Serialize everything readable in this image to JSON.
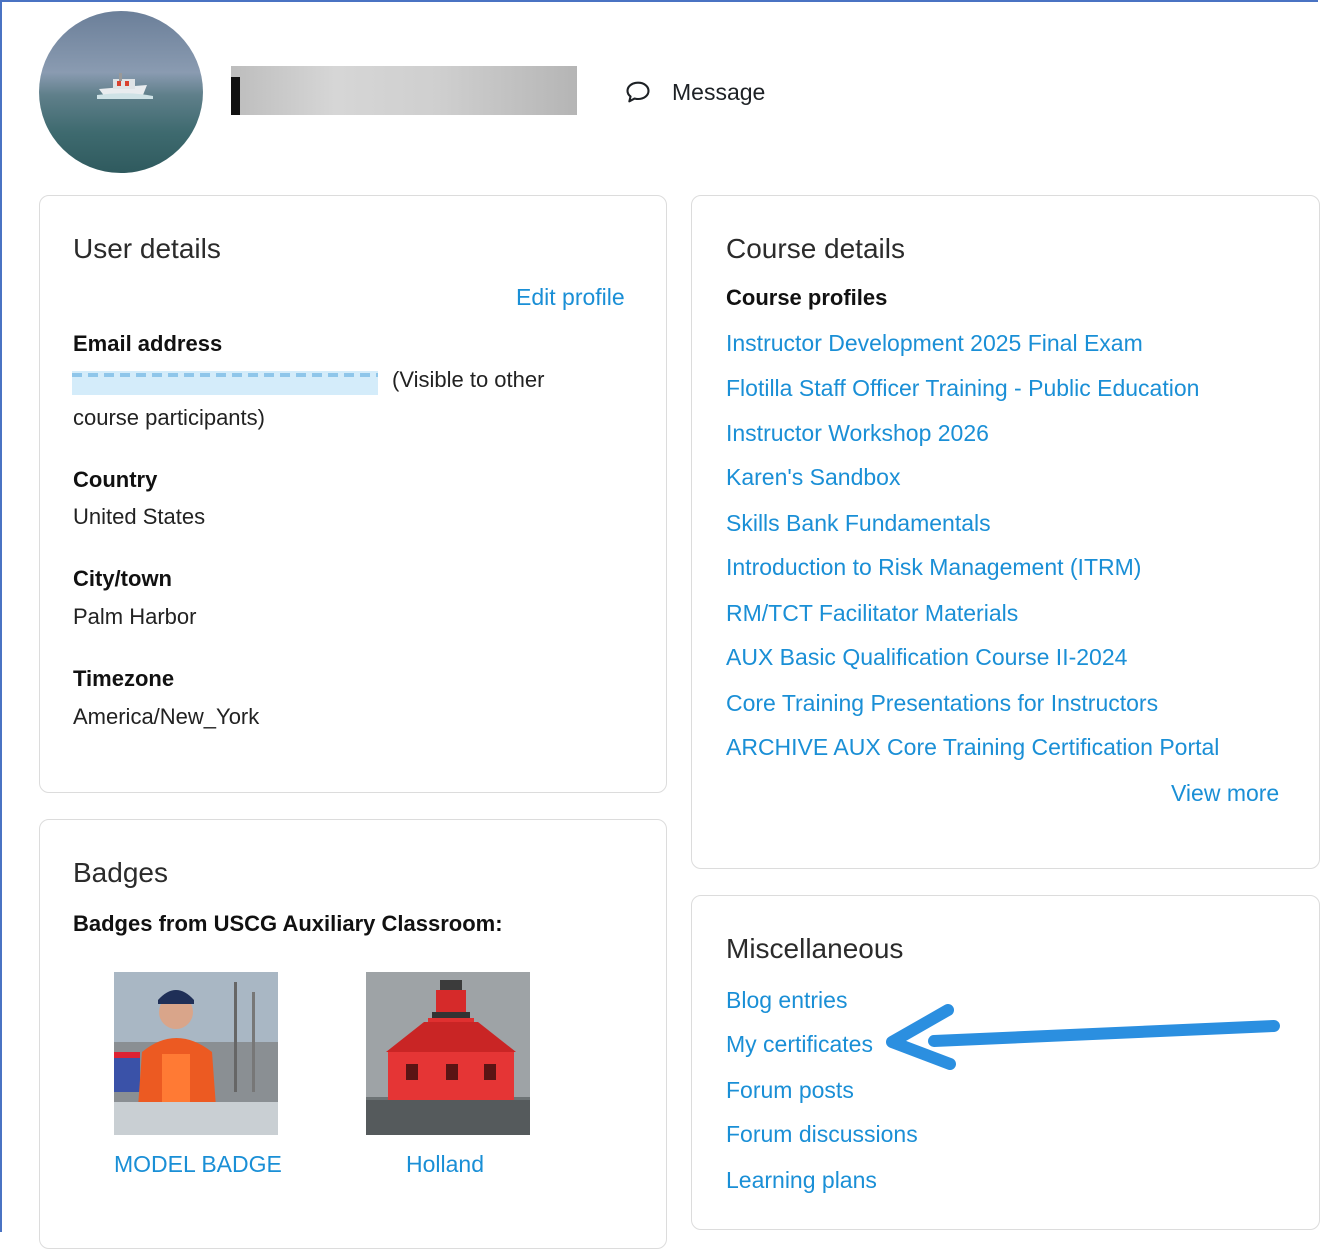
{
  "profile": {
    "message_label": "Message"
  },
  "user_details": {
    "title": "User details",
    "edit_profile": "Edit profile",
    "email_label": "Email address",
    "email_note_1": "(Visible to other",
    "email_note_2": "course participants)",
    "country_label": "Country",
    "country_value": "United States",
    "city_label": "City/town",
    "city_value": "Palm Harbor",
    "timezone_label": "Timezone",
    "timezone_value": "America/New_York"
  },
  "course_details": {
    "title": "Course details",
    "profiles_label": "Course profiles",
    "courses": [
      "Instructor Development 2025 Final Exam",
      "Flotilla Staff Officer Training - Public Education",
      "Instructor Workshop 2026",
      "Karen's Sandbox",
      "Skills Bank Fundamentals",
      "Introduction to Risk Management (ITRM)",
      "RM/TCT Facilitator Materials",
      "AUX Basic Qualification Course II-2024",
      "Core Training Presentations for Instructors",
      "ARCHIVE AUX Core Training Certification Portal"
    ],
    "view_more": "View more"
  },
  "badges": {
    "title": "Badges",
    "subtitle": "Badges from USCG Auxiliary Classroom:",
    "items": [
      {
        "label": "MODEL BADGE"
      },
      {
        "label": "Holland"
      }
    ]
  },
  "misc": {
    "title": "Miscellaneous",
    "links": [
      "Blog entries",
      "My certificates",
      "Forum posts",
      "Forum discussions",
      "Learning plans"
    ]
  },
  "colors": {
    "link": "#1a8fd6",
    "annotation_arrow": "#2b8fe0"
  }
}
